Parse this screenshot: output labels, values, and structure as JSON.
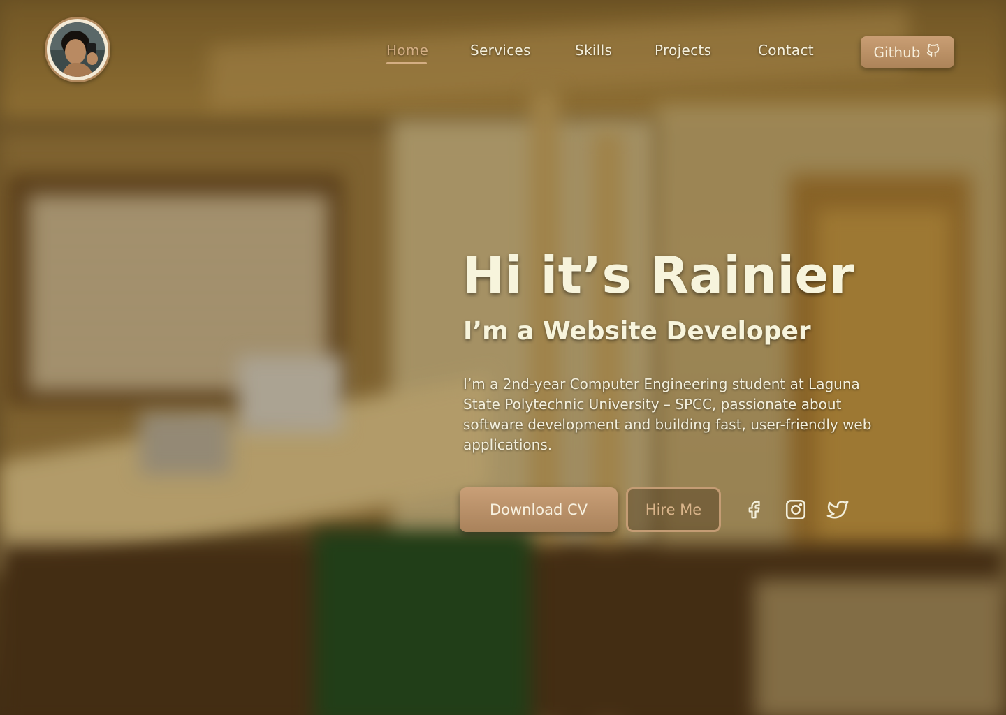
{
  "header": {
    "avatar_alt": "Profile photo",
    "nav": [
      {
        "label": "Home",
        "active": true
      },
      {
        "label": "Services",
        "active": false
      },
      {
        "label": "Skills",
        "active": false
      },
      {
        "label": "Projects",
        "active": false
      },
      {
        "label": "Contact",
        "active": false
      }
    ],
    "github_label": "Github",
    "github_icon": "github-icon"
  },
  "hero": {
    "title": "Hi it’s Rainier",
    "subtitle": "I’m a Website Developer",
    "description": "I’m a 2nd-year Computer Engineering student at Laguna State Polytechnic University – SPCC, passionate about software development and building fast, user-friendly web applications.",
    "primary_button": "Download CV",
    "secondary_button": "Hire Me"
  },
  "social": [
    "facebook-icon",
    "instagram-icon",
    "twitter-icon"
  ],
  "colors": {
    "accent": "#c99f77",
    "accent_text": "#d4ae83",
    "text": "#f7f4dc"
  }
}
